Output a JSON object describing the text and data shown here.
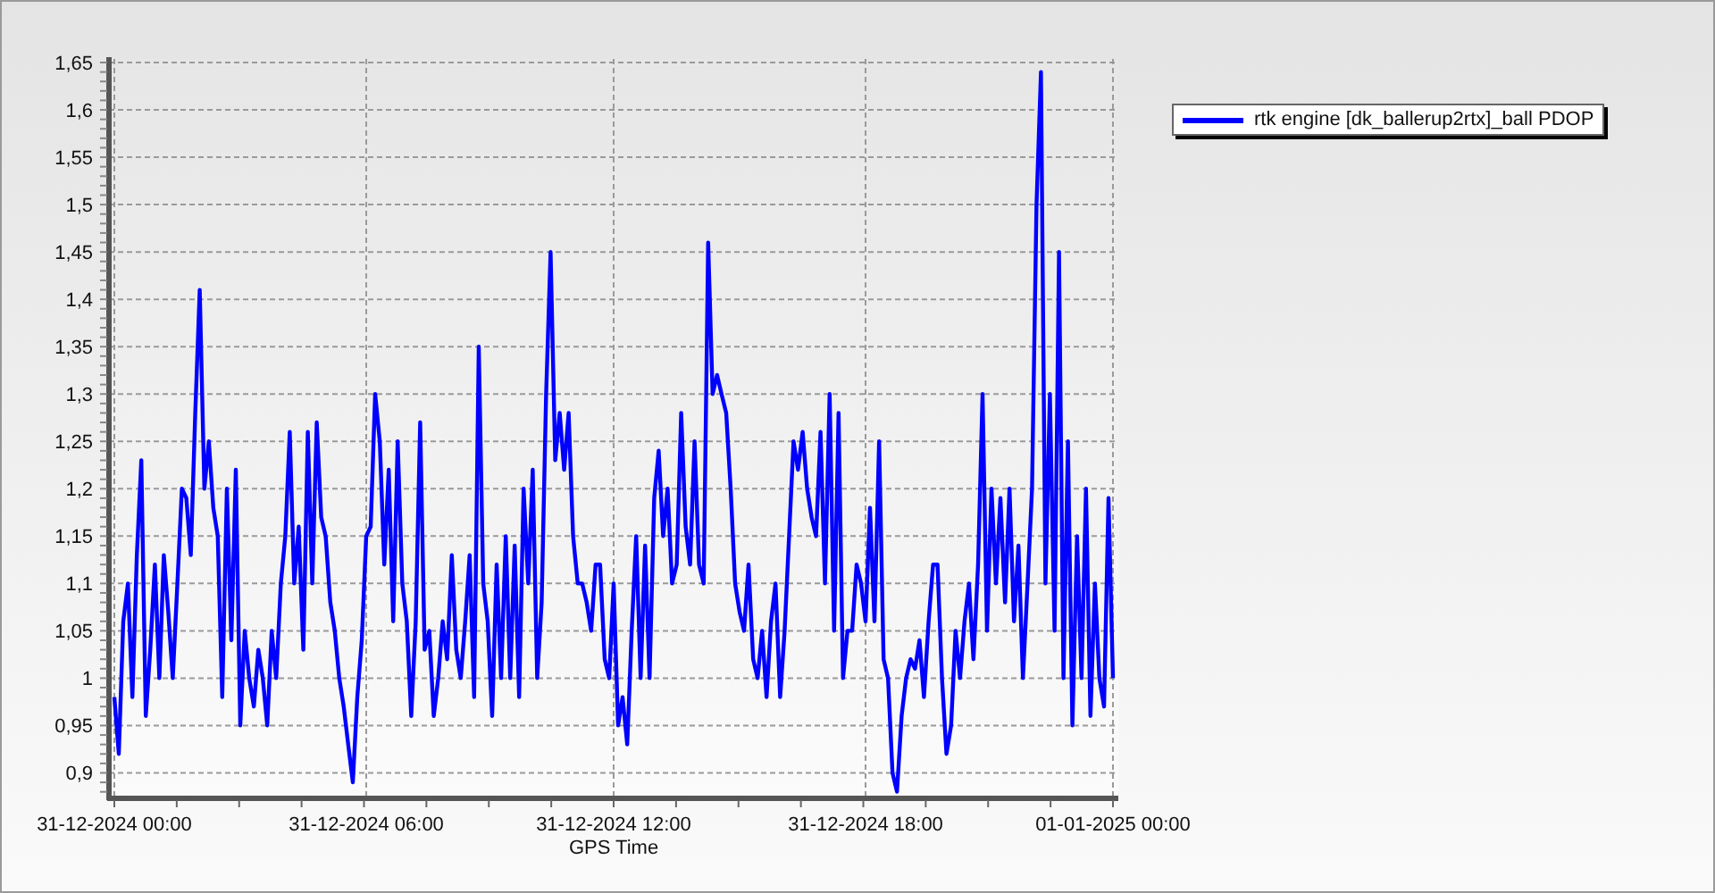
{
  "chart_data": {
    "type": "line",
    "xlabel": "GPS Time",
    "ylim": [
      0.875,
      1.65
    ],
    "grid": true,
    "categories": [
      "31-12-2024 00:00",
      null,
      null,
      null,
      null,
      null,
      null,
      null,
      null,
      null,
      null,
      null,
      null,
      null,
      null,
      null,
      null,
      null,
      null,
      null,
      null,
      null,
      null,
      null,
      null,
      null,
      null,
      null,
      null,
      null,
      null,
      null,
      null,
      null,
      null,
      null,
      null,
      null,
      null,
      null,
      null,
      null,
      null,
      null,
      null,
      null,
      null,
      null,
      null,
      null,
      null,
      null,
      null,
      null,
      null,
      null,
      "31-12-2024 06:00",
      null,
      null,
      null,
      null,
      null,
      null,
      null,
      null,
      null,
      null,
      null,
      null,
      null,
      null,
      null,
      null,
      null,
      null,
      null,
      null,
      null,
      null,
      null,
      null,
      null,
      null,
      null,
      null,
      null,
      null,
      null,
      null,
      null,
      null,
      null,
      null,
      null,
      null,
      null,
      null,
      null,
      null,
      null,
      null,
      null,
      null,
      null,
      null,
      null,
      null,
      null,
      null,
      null,
      null,
      "31-12-2024 12:00",
      null,
      null,
      null,
      null,
      null,
      null,
      null,
      null,
      null,
      null,
      null,
      null,
      null,
      null,
      null,
      null,
      null,
      null,
      null,
      null,
      null,
      null,
      null,
      null,
      null,
      null,
      null,
      null,
      null,
      null,
      null,
      null,
      null,
      null,
      null,
      null,
      null,
      null,
      null,
      null,
      null,
      null,
      null,
      null,
      null,
      null,
      null,
      null,
      null,
      null,
      null,
      null,
      null,
      null,
      null,
      "31-12-2024 18:00",
      null,
      null,
      null,
      null,
      null,
      null,
      null,
      null,
      null,
      null,
      null,
      null,
      null,
      null,
      null,
      null,
      null,
      null,
      null,
      null,
      null,
      null,
      null,
      null,
      null,
      null,
      null,
      null,
      null,
      null,
      null,
      null,
      null,
      null,
      null,
      null,
      null,
      null,
      null,
      null,
      null,
      null,
      null,
      null,
      null,
      null,
      null,
      null,
      null,
      null,
      null,
      null,
      null,
      null,
      "01-01-2025 00:00"
    ],
    "yticks": [
      {
        "value": 0.9,
        "label": "0,9"
      },
      {
        "value": 0.95,
        "label": "0,95"
      },
      {
        "value": 1,
        "label": "1"
      },
      {
        "value": 1.05,
        "label": "1,05"
      },
      {
        "value": 1.1,
        "label": "1,1"
      },
      {
        "value": 1.15,
        "label": "1,15"
      },
      {
        "value": 1.2,
        "label": "1,2"
      },
      {
        "value": 1.25,
        "label": "1,25"
      },
      {
        "value": 1.3,
        "label": "1,3"
      },
      {
        "value": 1.35,
        "label": "1,35"
      },
      {
        "value": 1.4,
        "label": "1,4"
      },
      {
        "value": 1.45,
        "label": "1,45"
      },
      {
        "value": 1.5,
        "label": "1,5"
      },
      {
        "value": 1.55,
        "label": "1,55"
      },
      {
        "value": 1.6,
        "label": "1,6"
      },
      {
        "value": 1.65,
        "label": "1,65"
      }
    ],
    "series": [
      {
        "name": "rtk engine [dk_ballerup2rtx]_ball PDOP",
        "color": "#0000ff",
        "values": [
          0.98,
          0.92,
          1.06,
          1.1,
          0.98,
          1.13,
          1.23,
          0.96,
          1.03,
          1.12,
          1.0,
          1.13,
          1.07,
          1.0,
          1.1,
          1.2,
          1.19,
          1.13,
          1.28,
          1.41,
          1.2,
          1.25,
          1.18,
          1.15,
          0.98,
          1.2,
          1.04,
          1.22,
          0.95,
          1.05,
          1.0,
          0.97,
          1.03,
          1.0,
          0.95,
          1.05,
          1.0,
          1.1,
          1.15,
          1.26,
          1.1,
          1.16,
          1.03,
          1.26,
          1.1,
          1.27,
          1.17,
          1.15,
          1.08,
          1.05,
          1.0,
          0.97,
          0.93,
          0.89,
          0.98,
          1.04,
          1.15,
          1.16,
          1.3,
          1.25,
          1.12,
          1.22,
          1.06,
          1.25,
          1.1,
          1.06,
          0.96,
          1.06,
          1.27,
          1.03,
          1.05,
          0.96,
          1.0,
          1.06,
          1.02,
          1.13,
          1.03,
          1.0,
          1.06,
          1.13,
          0.98,
          1.35,
          1.1,
          1.06,
          0.96,
          1.12,
          1.0,
          1.15,
          1.0,
          1.14,
          0.98,
          1.2,
          1.1,
          1.22,
          1.0,
          1.08,
          1.3,
          1.45,
          1.23,
          1.28,
          1.22,
          1.28,
          1.15,
          1.1,
          1.1,
          1.08,
          1.05,
          1.12,
          1.12,
          1.02,
          1.0,
          1.1,
          0.95,
          0.98,
          0.93,
          1.05,
          1.15,
          1.0,
          1.14,
          1.0,
          1.19,
          1.24,
          1.15,
          1.2,
          1.1,
          1.12,
          1.28,
          1.16,
          1.12,
          1.25,
          1.12,
          1.1,
          1.46,
          1.3,
          1.32,
          1.3,
          1.28,
          1.2,
          1.1,
          1.07,
          1.05,
          1.12,
          1.02,
          1.0,
          1.05,
          0.98,
          1.06,
          1.1,
          0.98,
          1.05,
          1.15,
          1.25,
          1.22,
          1.26,
          1.2,
          1.17,
          1.15,
          1.26,
          1.1,
          1.3,
          1.05,
          1.28,
          1.0,
          1.05,
          1.05,
          1.12,
          1.1,
          1.06,
          1.18,
          1.06,
          1.25,
          1.02,
          1.0,
          0.9,
          0.88,
          0.96,
          1.0,
          1.02,
          1.01,
          1.04,
          0.98,
          1.06,
          1.12,
          1.12,
          1.0,
          0.92,
          0.95,
          1.05,
          1.0,
          1.06,
          1.1,
          1.02,
          1.12,
          1.3,
          1.05,
          1.2,
          1.1,
          1.19,
          1.08,
          1.2,
          1.06,
          1.14,
          1.0,
          1.1,
          1.2,
          1.5,
          1.64,
          1.1,
          1.3,
          1.05,
          1.45,
          1.0,
          1.25,
          0.95,
          1.15,
          1.0,
          1.2,
          0.96,
          1.1,
          1.0,
          0.97,
          1.19,
          1.0
        ]
      }
    ]
  }
}
